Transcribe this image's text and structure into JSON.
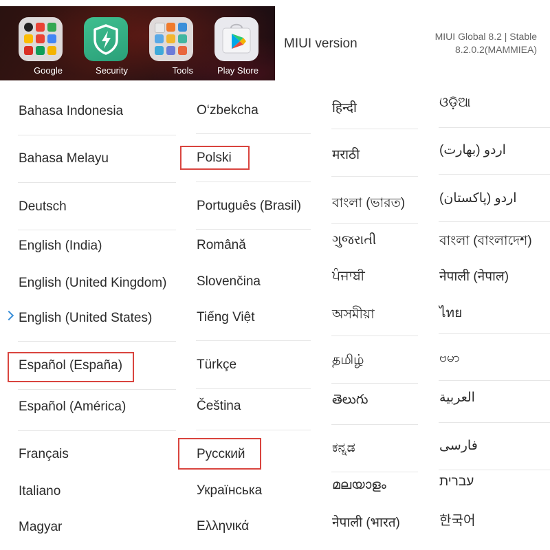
{
  "launcher": {
    "apps": [
      {
        "label": "Google",
        "icon": "google-folder-icon"
      },
      {
        "label": "Security",
        "icon": "security-shield-icon"
      },
      {
        "label": "Tools",
        "icon": "tools-folder-icon"
      },
      {
        "label": "Play Store",
        "icon": "play-store-icon"
      }
    ]
  },
  "version": {
    "key": "MIUI version",
    "line1": "MIUI Global 8.2 | Stable",
    "line2": "8.2.0.2(MAMMIEA)"
  },
  "languages": {
    "col1": [
      "Bahasa Indonesia",
      "Bahasa Melayu",
      "Deutsch",
      "English (India)",
      "English (United Kingdom)",
      "English (United States)",
      "Español (España)",
      "Español (América)",
      "Français",
      "Italiano",
      "Magyar"
    ],
    "col2": [
      "O‘zbekcha",
      "Polski",
      "Português (Brasil)",
      "Română",
      "Slovenčina",
      "Tiếng Việt",
      "Türkçe",
      "Čeština",
      "Русский",
      "Українська",
      "Ελληνικά"
    ],
    "col3": [
      "हिन्दी",
      "मराठी",
      "বাংলা (ভারত)",
      "ગુજરાતી",
      "ਪੰਜਾਬੀ",
      "অসমীয়া",
      "தமிழ்",
      "తెలుగు",
      "ಕನ್ನಡ",
      "മലയാളം",
      "नेपाली (भारत)"
    ],
    "col4": [
      "ଓଡ଼ିଆ",
      "اردو (بھارت)",
      "اردو (پاکستان)",
      "বাংলা (বাংলাদেশ)",
      "नेपाली (नेपाल)",
      "ไทย",
      "ဗမာ",
      "العربية",
      "فارسی",
      "עברית",
      "한국어"
    ],
    "selected": "English (United States)",
    "highlighted": [
      "Polski",
      "Español (España)",
      "Русский"
    ]
  },
  "colors": {
    "highlight": "#d9443e",
    "selected_chevron": "#3a8fd9"
  }
}
